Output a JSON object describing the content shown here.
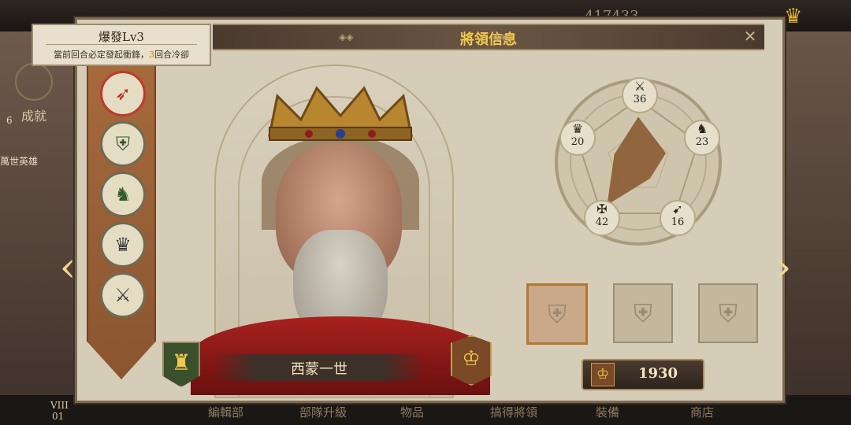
{
  "background": {
    "top_numbers": "417433",
    "left": {
      "achievement_label": "成就",
      "achievement_count": "6",
      "hero_label": "萬世英雄"
    },
    "bottom_menu": [
      "編輯部",
      "部隊升級",
      "物品",
      "搞得將領",
      "裝備",
      "商店"
    ],
    "bottom_left": {
      "level": "VIII",
      "sub": "01"
    }
  },
  "panel": {
    "title": "將領信息",
    "close_icon": "close-icon"
  },
  "skill_tooltip": {
    "name": "爆發Lv3",
    "desc_prefix": "當前回合必定發起衝鋒，",
    "desc_highlight": "3",
    "desc_suffix": "回合冷卻"
  },
  "skills": [
    {
      "name": "spear",
      "icon": "spear-icon",
      "active": true
    },
    {
      "name": "shield",
      "icon": "shield-icon",
      "active": false
    },
    {
      "name": "horse",
      "icon": "horse-icon",
      "active": false
    },
    {
      "name": "crown",
      "icon": "crown-icon",
      "active": false
    },
    {
      "name": "sword-scroll",
      "icon": "sword-scroll-icon",
      "active": false
    }
  ],
  "hero": {
    "name": "西蒙一世"
  },
  "stats": [
    {
      "key": "attack",
      "icon": "crossed-swords-icon",
      "value": "36"
    },
    {
      "key": "cavalry",
      "icon": "horse-head-icon",
      "value": "23"
    },
    {
      "key": "archery",
      "icon": "bow-icon",
      "value": "16"
    },
    {
      "key": "defense",
      "icon": "eagle-icon",
      "value": "42"
    },
    {
      "key": "leadership",
      "icon": "crown-icon",
      "value": "20"
    }
  ],
  "equipment_slots": [
    {
      "state": "selected"
    },
    {
      "state": "empty"
    },
    {
      "state": "empty"
    }
  ],
  "power": {
    "icon": "crown-badge-icon",
    "value": "1930"
  },
  "colors": {
    "title_gold": "#f2c94c",
    "panel_bg": "#d6cdb8",
    "skill_rail": "#a66a3c"
  }
}
